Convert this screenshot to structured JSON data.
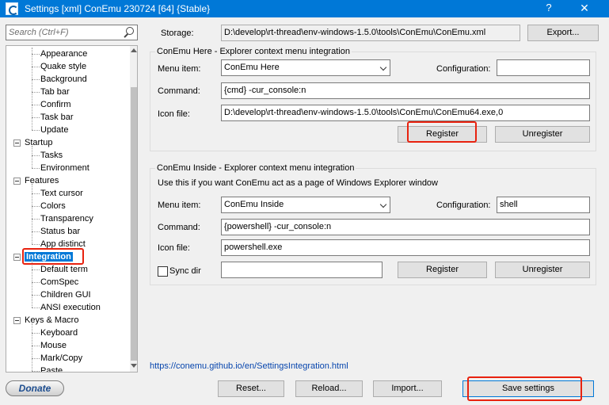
{
  "window": {
    "title": "Settings [xml] ConEmu 230724 [64] {Stable}",
    "help": "?",
    "close": "✕"
  },
  "sidebar": {
    "search_placeholder": "Search (Ctrl+F)",
    "donate": "Donate",
    "tree": [
      {
        "label": "Appearance",
        "level": 1
      },
      {
        "label": "Quake style",
        "level": 1
      },
      {
        "label": "Background",
        "level": 1
      },
      {
        "label": "Tab bar",
        "level": 1
      },
      {
        "label": "Confirm",
        "level": 1
      },
      {
        "label": "Task bar",
        "level": 1
      },
      {
        "label": "Update",
        "level": 1
      },
      {
        "label": "Startup",
        "level": 0
      },
      {
        "label": "Tasks",
        "level": 1
      },
      {
        "label": "Environment",
        "level": 1
      },
      {
        "label": "Features",
        "level": 0
      },
      {
        "label": "Text cursor",
        "level": 1
      },
      {
        "label": "Colors",
        "level": 1
      },
      {
        "label": "Transparency",
        "level": 1
      },
      {
        "label": "Status bar",
        "level": 1
      },
      {
        "label": "App distinct",
        "level": 1
      },
      {
        "label": "Integration",
        "level": 0,
        "selected": true
      },
      {
        "label": "Default term",
        "level": 1
      },
      {
        "label": "ComSpec",
        "level": 1
      },
      {
        "label": "Children GUI",
        "level": 1
      },
      {
        "label": "ANSI execution",
        "level": 1
      },
      {
        "label": "Keys & Macro",
        "level": 0
      },
      {
        "label": "Keyboard",
        "level": 1
      },
      {
        "label": "Mouse",
        "level": 1
      },
      {
        "label": "Mark/Copy",
        "level": 1
      },
      {
        "label": "Paste",
        "level": 1
      }
    ]
  },
  "storage": {
    "label": "Storage:",
    "value": "D:\\develop\\rt-thread\\env-windows-1.5.0\\tools\\ConEmu\\ConEmu.xml",
    "export": "Export..."
  },
  "here": {
    "title": "ConEmu Here - Explorer context menu integration",
    "menu_item_label": "Menu item:",
    "menu_item_value": "ConEmu Here",
    "config_label": "Configuration:",
    "config_value": "",
    "command_label": "Command:",
    "command_value": "{cmd} -cur_console:n",
    "icon_label": "Icon file:",
    "icon_value": "D:\\develop\\rt-thread\\env-windows-1.5.0\\tools\\ConEmu\\ConEmu64.exe,0",
    "register": "Register",
    "unregister": "Unregister"
  },
  "inside": {
    "title": "ConEmu Inside - Explorer context menu integration",
    "description": "Use this if you want ConEmu act as a page of Windows Explorer window",
    "menu_item_label": "Menu item:",
    "menu_item_value": "ConEmu Inside",
    "config_label": "Configuration:",
    "config_value": "shell",
    "command_label": "Command:",
    "command_value": "{powershell} -cur_console:n",
    "icon_label": "Icon file:",
    "icon_value": "powershell.exe",
    "sync_label": "Sync dir",
    "sync_value": "",
    "register": "Register",
    "unregister": "Unregister"
  },
  "help_link": "https://conemu.github.io/en/SettingsIntegration.html",
  "footer": {
    "reset": "Reset...",
    "reload": "Reload...",
    "import": "Import...",
    "save": "Save settings"
  },
  "colors": {
    "titlebar": "#0078d7",
    "highlight": "#e8220f",
    "selection": "#0078d7"
  }
}
